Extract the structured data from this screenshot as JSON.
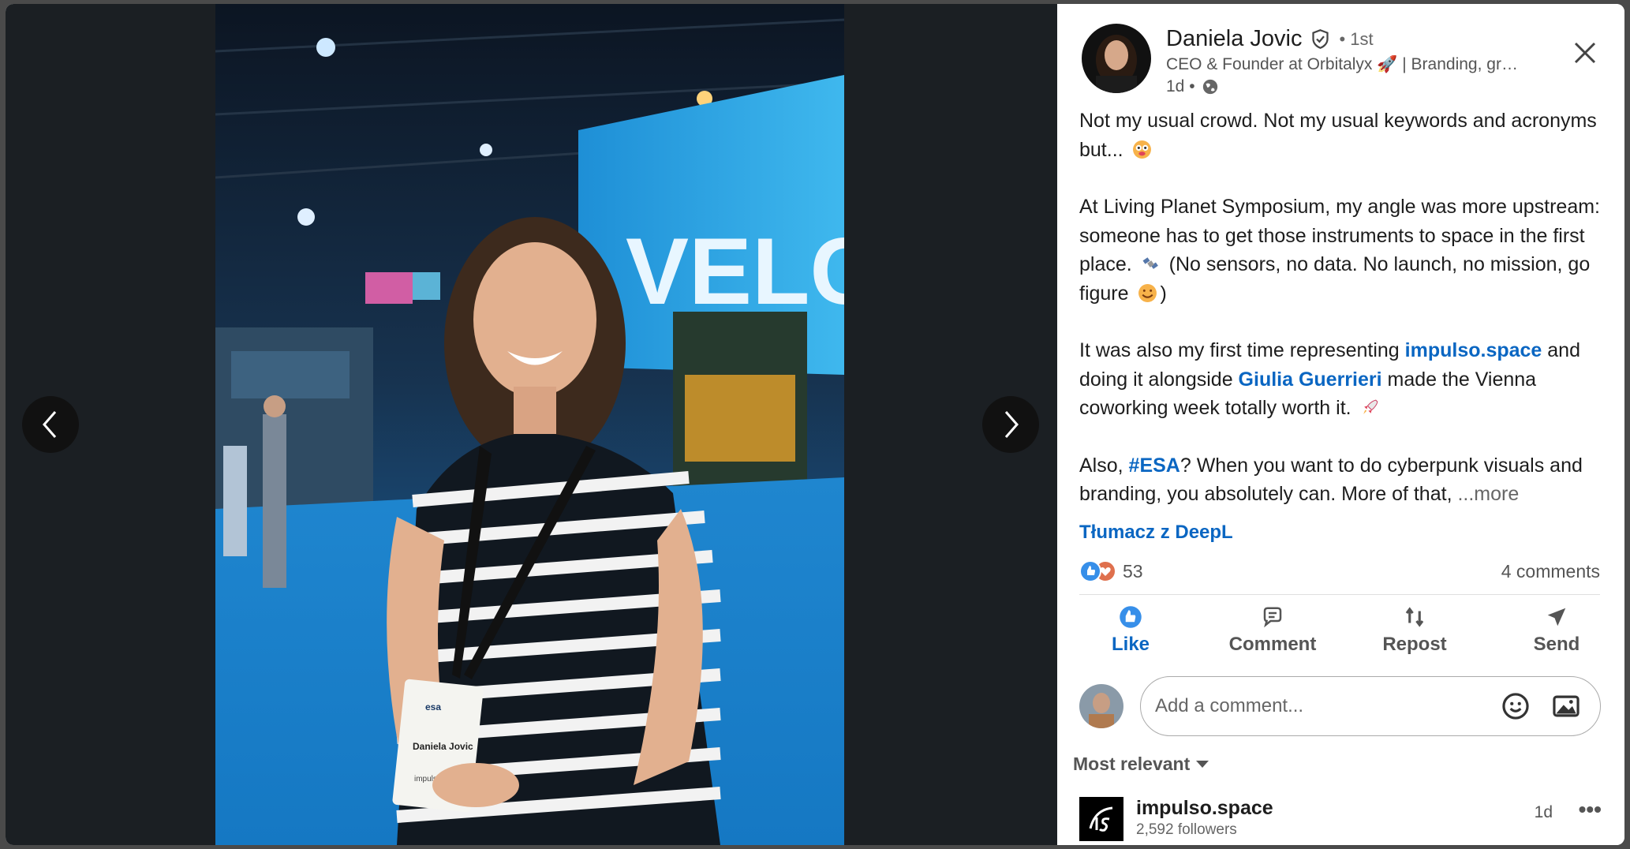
{
  "viewer": {
    "prev_icon": "chevron-left-icon",
    "next_icon": "chevron-right-icon",
    "photo_badge_name": "Daniela Jovic",
    "photo_badge_org": "impulso.space",
    "photo_badge_logo": "esa",
    "photo_screen_text": "VELC"
  },
  "post": {
    "author_name": "Daniela Jovic",
    "degree": "• 1st",
    "headline": "CEO & Founder at Orbitalyx 🚀 | Branding, gr…",
    "time": "1d •",
    "para1": "Not my usual crowd. Not my usual keywords and acronyms but...",
    "para2a": "At Living Planet Symposium, my angle was more upstream: someone has to get those instruments to space in the first place.",
    "para2b": "(No sensors, no data. No launch, no mission, go figure",
    "para2c": ")",
    "para3a": "It was also my first time representing",
    "para3_link1": "impulso.space",
    "para3b": "and doing it alongside",
    "para3_link2": "Giulia Guerrieri",
    "para3c": "made the Vienna coworking week totally worth it.",
    "para4a": "Also,",
    "para4_hashtag": "#ESA",
    "para4b": "? When you want to do cyberpunk visuals and branding, you absolutely can. More of that,",
    "more_label": "...more",
    "translate_label": "Tłumacz z DeepL",
    "reaction_count": "53",
    "comments_count": "4 comments"
  },
  "actions": {
    "like": "Like",
    "comment": "Comment",
    "repost": "Repost",
    "send": "Send"
  },
  "comment_input": {
    "placeholder": "Add a comment..."
  },
  "sort": {
    "label": "Most relevant"
  },
  "comment": {
    "author": "impulso.space",
    "followers": "2,592 followers",
    "time": "1d",
    "menu": "•••"
  },
  "colors": {
    "accent": "#0a66c2",
    "viewer_bg": "#1b1f23"
  }
}
